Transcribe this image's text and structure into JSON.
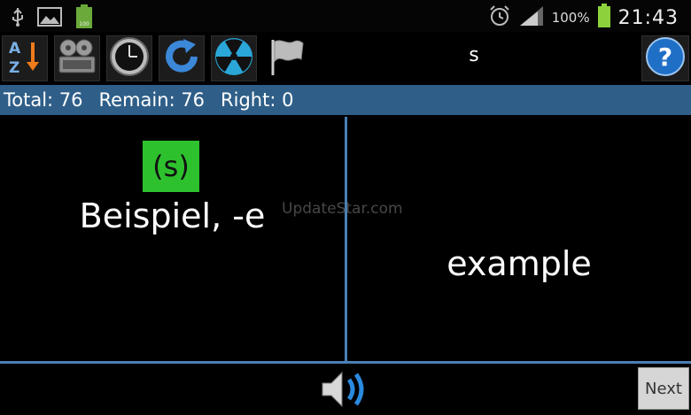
{
  "status_bar": {
    "battery_percent": "100%",
    "time": "21:43",
    "icons": [
      "usb-icon",
      "image-icon",
      "battery-full-icon",
      "alarm-icon",
      "signal-icon",
      "battery-icon"
    ]
  },
  "toolbar": {
    "buttons": [
      "sort-az-icon",
      "film-icon",
      "clock-icon",
      "refresh-icon",
      "radiation-icon",
      "flag-icon"
    ],
    "title": "s",
    "help_icon": "help-icon"
  },
  "stats": {
    "total": "Total: 76",
    "remain": "Remain: 76",
    "right": "Right: 0"
  },
  "card": {
    "article": "(s)",
    "word": "Beispiel, -e",
    "translation": "example"
  },
  "watermark": "UpdateStar.com",
  "footer": {
    "next_label": "Next"
  },
  "colors": {
    "stats_bar": "#2f5f88",
    "divider": "#4a7fb5",
    "article_bg": "#2ec12e"
  }
}
